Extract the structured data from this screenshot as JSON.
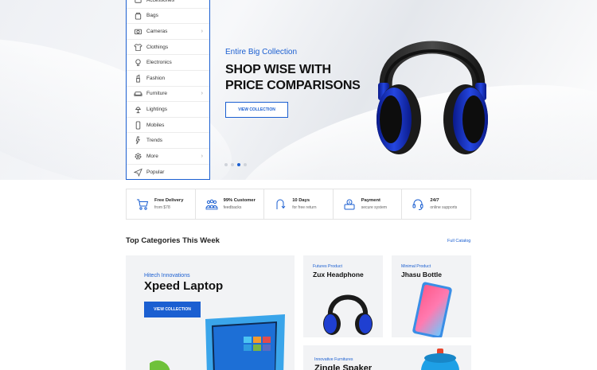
{
  "categories": [
    {
      "label": "Accessories",
      "icon": "accessories-icon",
      "has_sub": false
    },
    {
      "label": "Bags",
      "icon": "bag-icon",
      "has_sub": false
    },
    {
      "label": "Cameras",
      "icon": "camera-icon",
      "has_sub": true
    },
    {
      "label": "Clothings",
      "icon": "shirt-icon",
      "has_sub": false
    },
    {
      "label": "Electronics",
      "icon": "bulb-icon",
      "has_sub": false
    },
    {
      "label": "Fashion",
      "icon": "lipstick-icon",
      "has_sub": false
    },
    {
      "label": "Furniture",
      "icon": "sofa-icon",
      "has_sub": true
    },
    {
      "label": "Lightings",
      "icon": "lamp-icon",
      "has_sub": false
    },
    {
      "label": "Mobiles",
      "icon": "mobile-icon",
      "has_sub": false
    },
    {
      "label": "Trends",
      "icon": "trend-icon",
      "has_sub": false
    },
    {
      "label": "More",
      "icon": "gear-icon",
      "has_sub": true
    },
    {
      "label": "Popular",
      "icon": "send-icon",
      "has_sub": false
    }
  ],
  "chevron": "›",
  "hero": {
    "subtitle": "Entire Big Collection",
    "title_line1": "SHOP WISE WITH",
    "title_line2": "PRICE COMPARISONS",
    "button": "VIEW COLLECTION",
    "active_slide": 3,
    "slide_count": 4
  },
  "features": [
    {
      "title": "Free Delivery",
      "sub": "from $78",
      "icon": "cart-icon"
    },
    {
      "title": "99% Customer",
      "sub": "feedbacks",
      "icon": "people-icon"
    },
    {
      "title": "10 Days",
      "sub": "for free return",
      "icon": "return-icon"
    },
    {
      "title": "Payment",
      "sub": "secure system",
      "icon": "payment-icon"
    },
    {
      "title": "24/7",
      "sub": "online supports",
      "icon": "headset-icon"
    }
  ],
  "section": {
    "title": "Top Categories This Week",
    "link": "Full Catalog"
  },
  "cards": {
    "big": {
      "sub": "Hitech Innovations",
      "title": "Xpeed Laptop",
      "button": "VIEW COLLECTION"
    },
    "c1": {
      "sub": "Futures Product",
      "title": "Zux Headphone"
    },
    "c2": {
      "sub": "Minimal Product",
      "title": "Jhasu Bottle"
    },
    "c3": {
      "sub": "Innovative Furnitures",
      "title": "Zingle Spaker"
    }
  },
  "colors": {
    "accent": "#1b5fd1",
    "text": "#222222"
  }
}
